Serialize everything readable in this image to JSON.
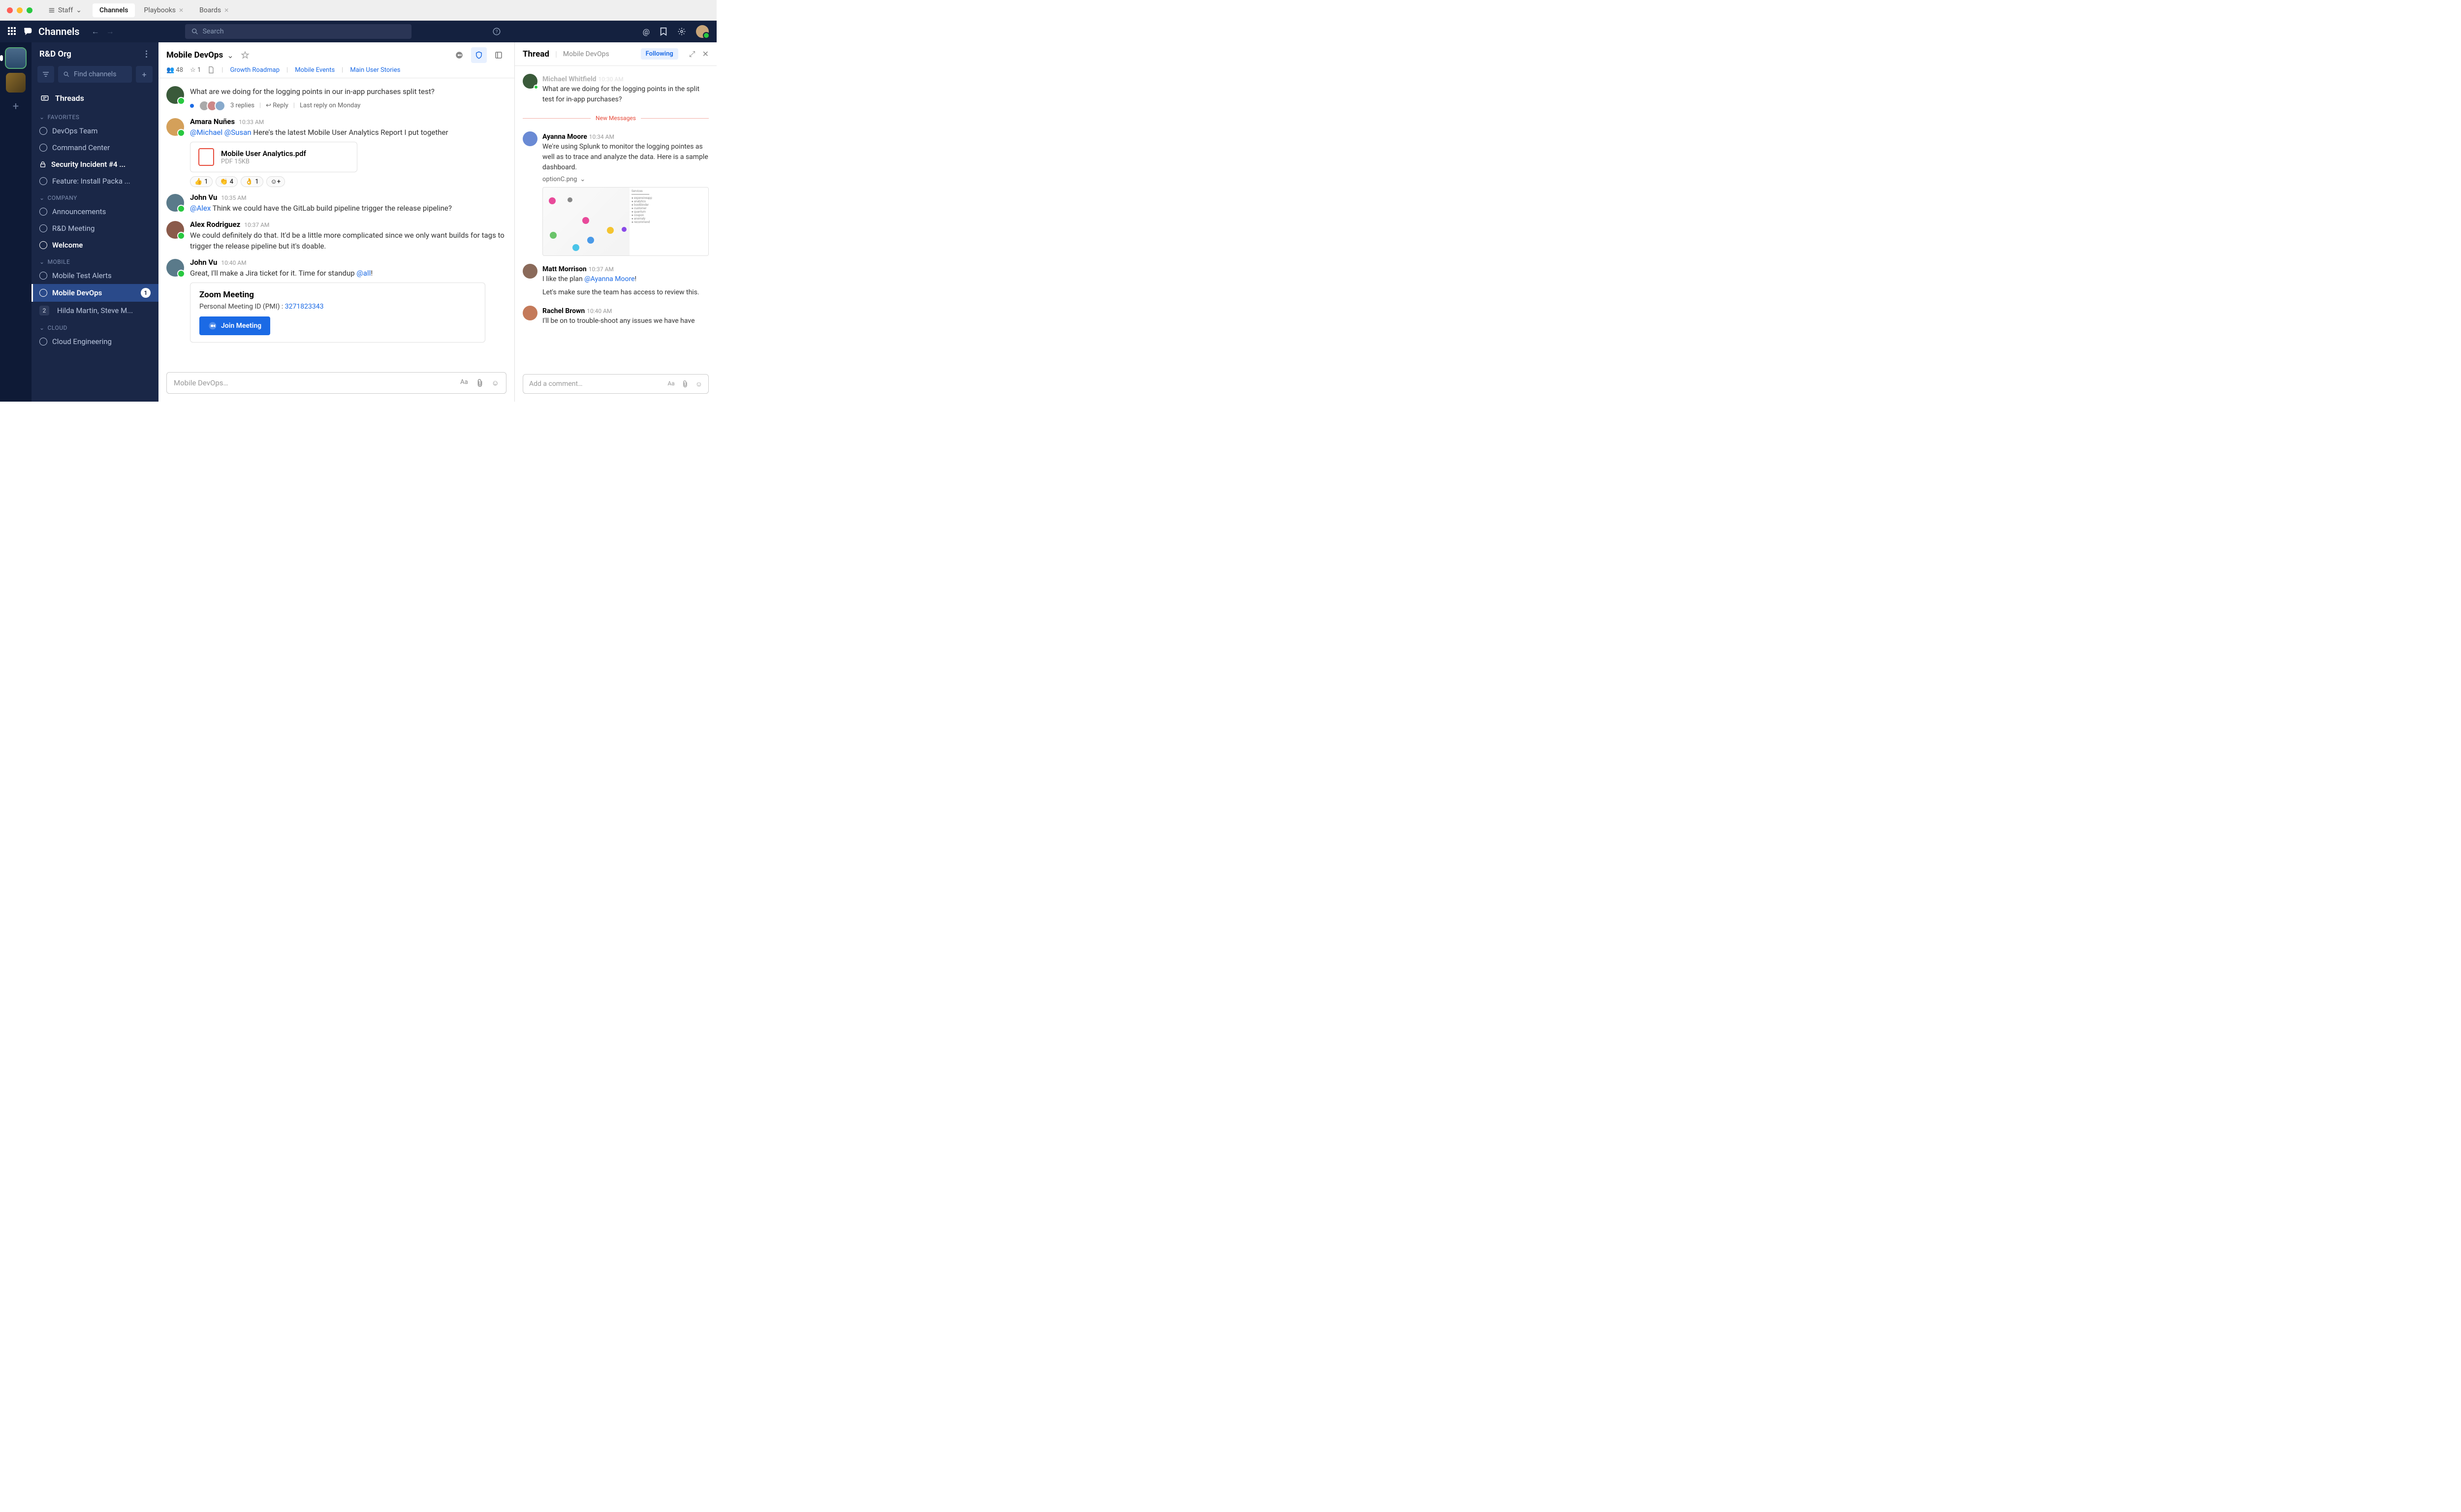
{
  "titlebar": {
    "staff_label": "Staff",
    "tabs": [
      {
        "label": "Channels",
        "active": true,
        "closable": false
      },
      {
        "label": "Playbooks",
        "active": false,
        "closable": true
      },
      {
        "label": "Boards",
        "active": false,
        "closable": true
      }
    ]
  },
  "header": {
    "brand": "Channels",
    "search_placeholder": "Search"
  },
  "sidebar": {
    "org": "R&D Org",
    "find_placeholder": "Find channels",
    "threads_label": "Threads",
    "sections": [
      {
        "title": "FAVORITES",
        "items": [
          {
            "icon": "globe",
            "label": "DevOps Team"
          },
          {
            "icon": "globe",
            "label": "Command Center"
          },
          {
            "icon": "lock",
            "label": "Security Incident #4 ...",
            "bold": true
          },
          {
            "icon": "globe",
            "label": "Feature: Install Packa ..."
          }
        ]
      },
      {
        "title": "COMPANY",
        "items": [
          {
            "icon": "globe",
            "label": "Announcements"
          },
          {
            "icon": "globe",
            "label": "R&D Meeting"
          },
          {
            "icon": "globe",
            "label": "Welcome",
            "bold": true
          }
        ]
      },
      {
        "title": "MOBILE",
        "items": [
          {
            "icon": "globe",
            "label": "Mobile Test Alerts"
          },
          {
            "icon": "globe",
            "label": "Mobile DevOps",
            "active": true,
            "badge": "1"
          },
          {
            "icon": "dm",
            "label": "Hilda Martin, Steve M...",
            "dm_count": "2"
          }
        ]
      },
      {
        "title": "CLOUD",
        "items": [
          {
            "icon": "globe",
            "label": "Cloud Engineering"
          }
        ]
      }
    ]
  },
  "channel": {
    "name": "Mobile DevOps",
    "members": "48",
    "pins": "1",
    "links": [
      "Growth Roadmap",
      "Mobile Events",
      "Main User Stories"
    ],
    "composer_placeholder": "Mobile DevOps…"
  },
  "messages": [
    {
      "type": "cont",
      "text": "What are we doing for the logging points in our in-app purchases split test?",
      "replies_count": "3 replies",
      "reply_label": "Reply",
      "last_reply": "Last reply on Monday"
    },
    {
      "name": "Amara Nuñes",
      "time": "10:33 AM",
      "mentions": "@Michael @Susan",
      "text": " Here's the latest Mobile User Analytics Report I put together",
      "attachment": {
        "name": "Mobile User Analytics.pdf",
        "meta": "PDF 15KB"
      },
      "reactions": [
        {
          "e": "👍",
          "c": "1"
        },
        {
          "e": "👏",
          "c": "4"
        },
        {
          "e": "👌",
          "c": "1"
        }
      ]
    },
    {
      "name": "John Vu",
      "time": "10:35 AM",
      "mentions": "@Alex",
      "text": " Think we could have the GitLab build pipeline trigger the release pipeline?"
    },
    {
      "name": "Alex Rodriguez",
      "time": "10:37 AM",
      "text": "We could definitely do that. It'd be a little more complicated since we only want builds for tags to trigger the release pipeline but it's doable."
    },
    {
      "name": "John Vu",
      "time": "10:40 AM",
      "text": "Great, I'll make a Jira ticket for it. Time for standup ",
      "mention_end": "@all",
      "zoom": {
        "title": "Zoom Meeting",
        "pmi_label": "Personal Meeting ID (PMI) : ",
        "pmi": "3271823343",
        "join": "Join Meeting"
      }
    }
  ],
  "thread": {
    "title": "Thread",
    "channel": "Mobile DevOps",
    "follow": "Following",
    "new_messages": "New Messages",
    "root": {
      "name": "Michael Whitfield",
      "time": "10:30 AM",
      "text": "What are we doing for the logging points in the split test for in-app purchases?"
    },
    "replies": [
      {
        "name": "Ayanna Moore",
        "time": "10:34 AM",
        "text": "We're using Splunk to monitor the logging pointes as well as to trace and analyze the data. Here is a sample dashboard.",
        "image_name": "optionC.png"
      },
      {
        "name": "Matt Morrison",
        "time": "10:37 AM",
        "text1": "I like the plan ",
        "mention": "@Ayanna Moore",
        "text1b": "!",
        "text2": "Let's make sure the team has access to review this."
      },
      {
        "name": "Rachel Brown",
        "time": "10:40 AM",
        "text": "I'll be on to trouble-shoot any issues we have have"
      }
    ],
    "composer_placeholder": "Add a comment…"
  }
}
